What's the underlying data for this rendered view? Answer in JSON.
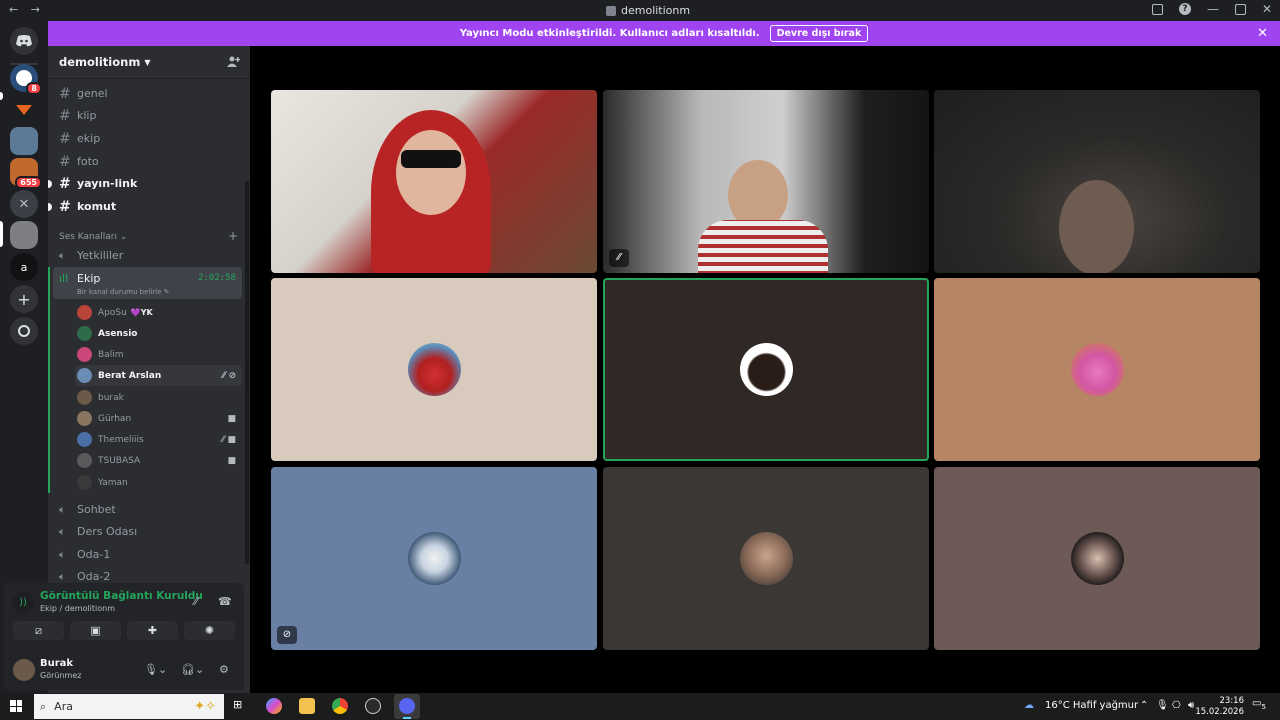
{
  "window": {
    "title": "demolitionm",
    "nav_back": "←",
    "nav_forward": "→"
  },
  "servers": {
    "badges": [
      "8",
      "655"
    ],
    "letter": "a"
  },
  "banner": {
    "text": "Yayıncı Modu etkinleştirildi. Kullanıcı adları kısaltıldı.",
    "button": "Devre dışı bırak"
  },
  "guild": {
    "name": "demolitionm"
  },
  "text_channels": [
    {
      "name": "genel"
    },
    {
      "name": "klip"
    },
    {
      "name": "ekip"
    },
    {
      "name": "foto"
    },
    {
      "name": "yayın-link"
    },
    {
      "name": "komut"
    }
  ],
  "voice_category": "Ses Kanalları",
  "voice_channels": {
    "yetkililer": "Yetkililer",
    "ekip": {
      "name": "Ekip",
      "timer": "2:02:58",
      "status": "Bir kanal durumu belirle"
    },
    "others": [
      "Sohbet",
      "Ders Odası",
      "Oda-1",
      "Oda-2"
    ]
  },
  "members": [
    {
      "name": "ApoSu",
      "tag": "YK"
    },
    {
      "name": "Asensio"
    },
    {
      "name": "Balim"
    },
    {
      "name": "Berat Arslan"
    },
    {
      "name": "burak"
    },
    {
      "name": "Gürhan"
    },
    {
      "name": "Themeliiis"
    },
    {
      "name": "TSUBASA"
    },
    {
      "name": "Yaman"
    }
  ],
  "voice_panel": {
    "title": "Görüntülü Bağlantı Kuruldu",
    "subtitle": "Ekip / demolitionm"
  },
  "user_panel": {
    "name": "Burak",
    "status": "Görünmez"
  },
  "taskbar": {
    "search_placeholder": "Ara",
    "weather": "16°C  Hafif yağmur",
    "time": "23:16",
    "date": "15.02.2026",
    "notif": "5"
  },
  "colors": {
    "accent_green": "#23a55a",
    "banner_purple": "#a044f2",
    "bg": "#1e1f22"
  }
}
